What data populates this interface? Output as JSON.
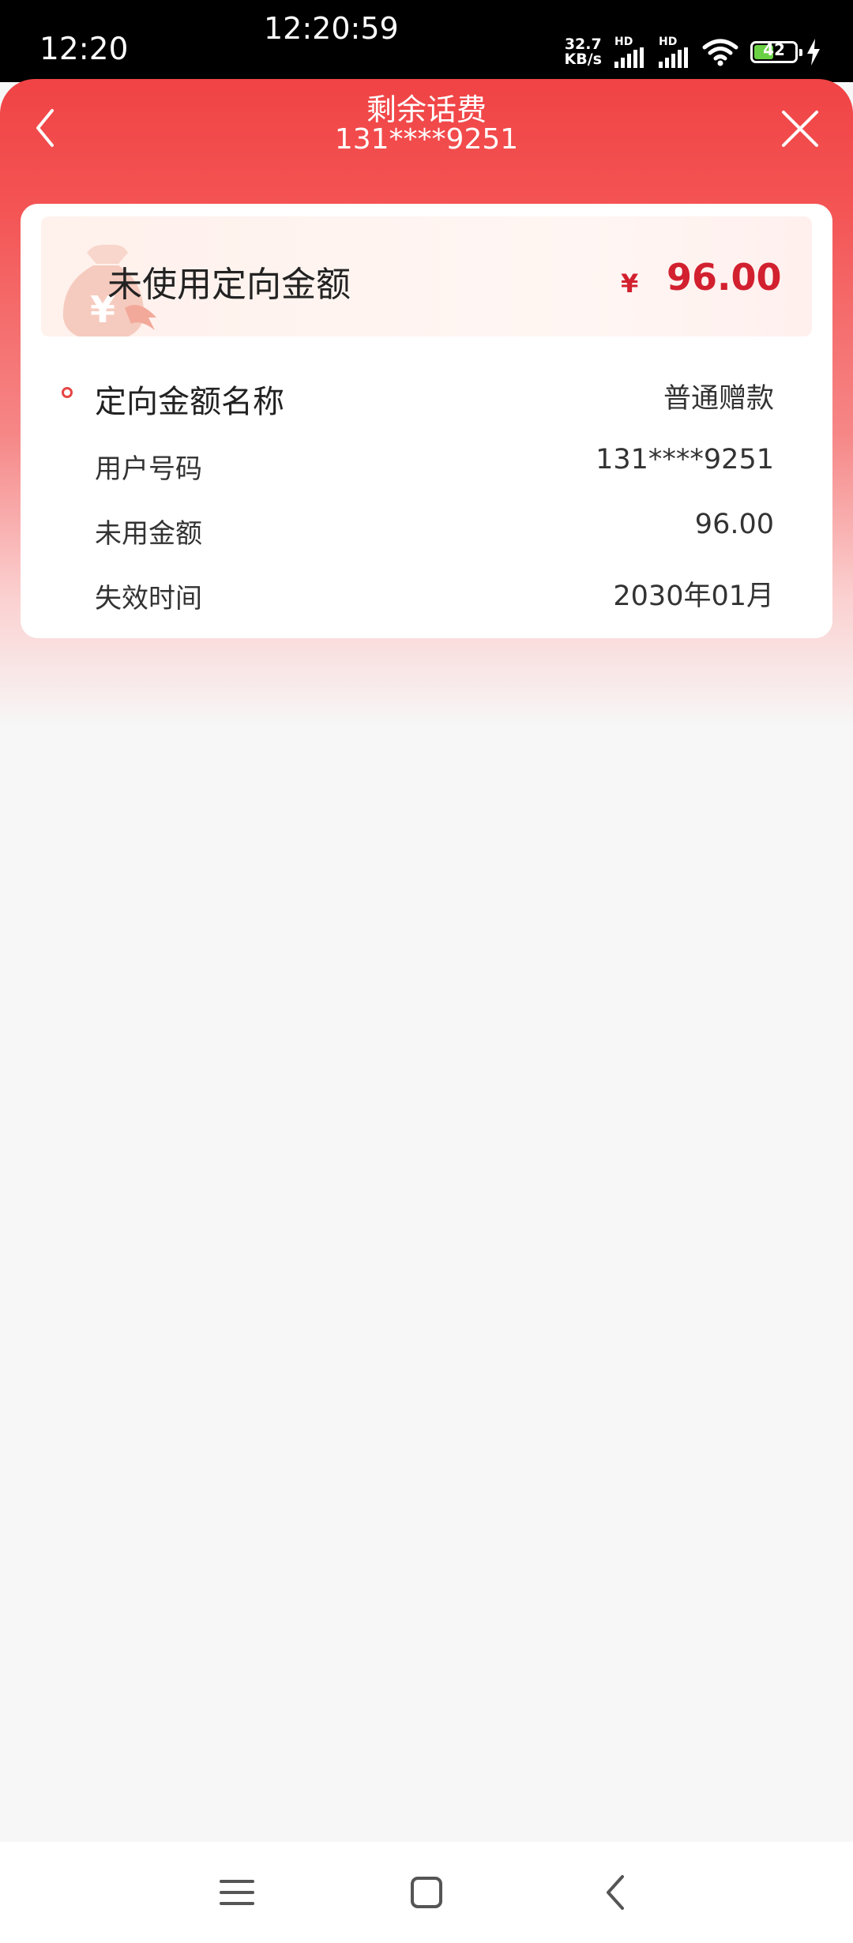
{
  "status": {
    "time": "12:20",
    "clock": "12:20:59",
    "net_speed_value": "32.7",
    "net_speed_unit": "KB/s",
    "hd1": "HD",
    "hd2": "HD",
    "battery": "42"
  },
  "header": {
    "title": "剩余话费",
    "phone": "131****9251",
    "back_icon": "chevron-left-icon",
    "close_icon": "close-icon"
  },
  "summary": {
    "label": "未使用定向金额",
    "currency": "¥",
    "amount": "96.00"
  },
  "detail": {
    "name_label": "定向金额名称",
    "name_value": "普通赠款",
    "rows": [
      {
        "label": "用户号码",
        "value": "131****9251"
      },
      {
        "label": "未用金额",
        "value": "96.00"
      },
      {
        "label": "失效时间",
        "value": "2030年01月"
      }
    ]
  },
  "colors": {
    "header_red": "#f04345",
    "amount_red": "#d2202f"
  },
  "system_nav": [
    "menu-icon",
    "home-icon",
    "back-icon"
  ]
}
